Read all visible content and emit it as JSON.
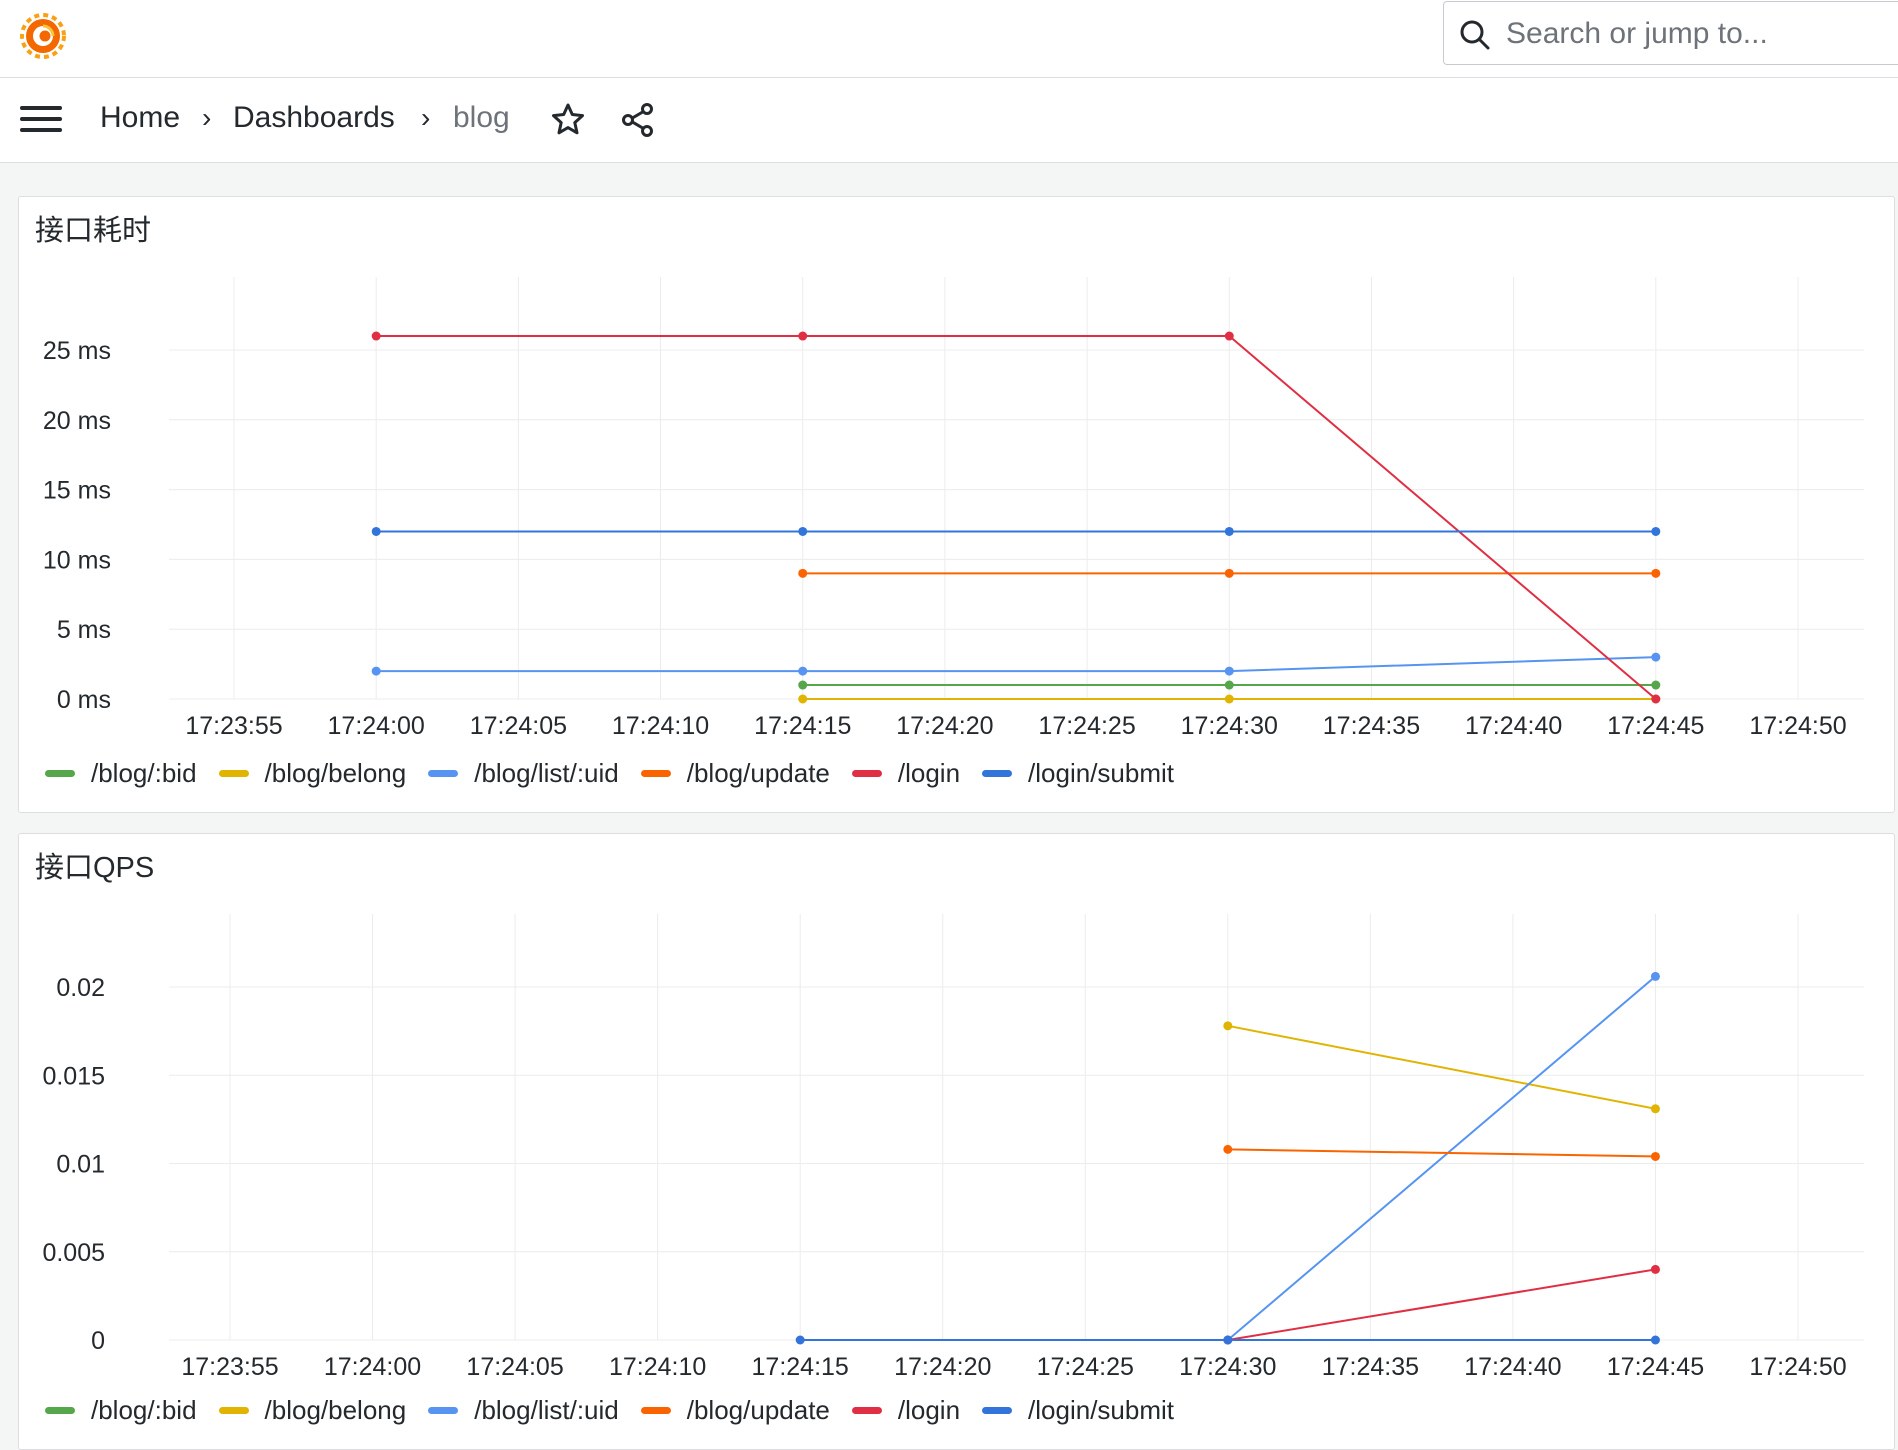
{
  "topbar": {
    "logo": "grafana-logo",
    "search": {
      "icon": "search-icon",
      "placeholder": "Search or jump to..."
    }
  },
  "navbar": {
    "menu_icon": "hamburger-menu-icon",
    "breadcrumbs": [
      "Home",
      "Dashboards",
      "blog"
    ],
    "separator": "›",
    "star_icon": "star-icon",
    "share_icon": "share-icon"
  },
  "colors": {
    "/blog/:bid": "#56a64b",
    "/blog/belong": "#e0b400",
    "/blog/list/:uid": "#5794f2",
    "/blog/update": "#fa6400",
    "/login": "#e02f44",
    "/login/submit": "#3274d9",
    "grid": "#ececec"
  },
  "chart_data": [
    {
      "type": "line",
      "title": "接口耗时",
      "x_ticks": [
        "17:23:55",
        "17:24:00",
        "17:24:05",
        "17:24:10",
        "17:24:15",
        "17:24:20",
        "17:24:25",
        "17:24:30",
        "17:24:35",
        "17:24:40",
        "17:24:45",
        "17:24:50"
      ],
      "y_ticks": [
        "0 ms",
        "5 ms",
        "10 ms",
        "15 ms",
        "20 ms",
        "25 ms"
      ],
      "ylim": [
        0,
        29
      ],
      "grid": true,
      "legend_position": "bottom-left",
      "series": [
        {
          "name": "/blog/:bid",
          "x": [
            "17:24:15",
            "17:24:30",
            "17:24:45"
          ],
          "y": [
            1,
            1,
            1
          ]
        },
        {
          "name": "/blog/belong",
          "x": [
            "17:24:15",
            "17:24:30",
            "17:24:45"
          ],
          "y": [
            0,
            0,
            0
          ]
        },
        {
          "name": "/blog/list/:uid",
          "x": [
            "17:24:00",
            "17:24:15",
            "17:24:30",
            "17:24:45"
          ],
          "y": [
            2,
            2,
            2,
            3
          ]
        },
        {
          "name": "/blog/update",
          "x": [
            "17:24:15",
            "17:24:30",
            "17:24:45"
          ],
          "y": [
            9,
            9,
            9
          ]
        },
        {
          "name": "/login",
          "x": [
            "17:24:00",
            "17:24:15",
            "17:24:30",
            "17:24:45"
          ],
          "y": [
            26,
            26,
            26,
            0
          ]
        },
        {
          "name": "/login/submit",
          "x": [
            "17:24:00",
            "17:24:15",
            "17:24:30",
            "17:24:45"
          ],
          "y": [
            12,
            12,
            12,
            12
          ]
        }
      ]
    },
    {
      "type": "line",
      "title": "接口QPS",
      "x_ticks": [
        "17:23:55",
        "17:24:00",
        "17:24:05",
        "17:24:10",
        "17:24:15",
        "17:24:20",
        "17:24:25",
        "17:24:30",
        "17:24:35",
        "17:24:40",
        "17:24:45",
        "17:24:50"
      ],
      "y_ticks": [
        "0",
        "0.005",
        "0.01",
        "0.015",
        "0.02"
      ],
      "ylim": [
        0,
        0.023
      ],
      "grid": true,
      "legend_position": "bottom-left",
      "series": [
        {
          "name": "/blog/:bid",
          "x": [],
          "y": []
        },
        {
          "name": "/blog/belong",
          "x": [
            "17:24:30",
            "17:24:45"
          ],
          "y": [
            0.0178,
            0.0131
          ]
        },
        {
          "name": "/blog/list/:uid",
          "x": [
            "17:24:30",
            "17:24:45"
          ],
          "y": [
            0,
            0.0206
          ]
        },
        {
          "name": "/blog/update",
          "x": [
            "17:24:30",
            "17:24:45"
          ],
          "y": [
            0.0108,
            0.0104
          ]
        },
        {
          "name": "/login",
          "x": [
            "17:24:30",
            "17:24:45"
          ],
          "y": [
            0,
            0.004
          ]
        },
        {
          "name": "/login/submit",
          "x": [
            "17:24:15",
            "17:24:30",
            "17:24:45"
          ],
          "y": [
            0,
            0,
            0
          ]
        }
      ]
    }
  ]
}
